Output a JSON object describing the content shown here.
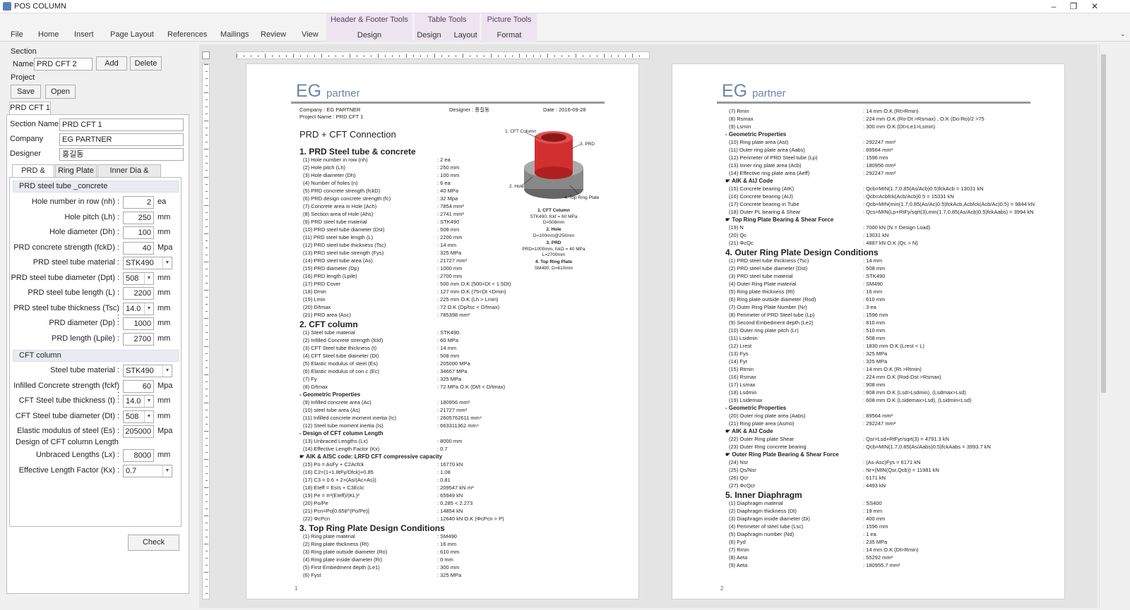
{
  "window": {
    "title": "POS COLUMN",
    "min_glyph": "–",
    "restore_glyph": "❐",
    "close_glyph": "✕"
  },
  "ribbon": {
    "tabs": [
      "File",
      "Home",
      "Insert",
      "Page Layout",
      "References",
      "Mailings",
      "Review",
      "View"
    ],
    "context_groups": [
      {
        "title": "Header & Footer Tools",
        "tabs": [
          "Design"
        ]
      },
      {
        "title": "Table Tools",
        "tabs": [
          "Design",
          "Layout"
        ]
      },
      {
        "title": "Picture Tools",
        "tabs": [
          "Format"
        ]
      }
    ]
  },
  "left": {
    "section_group": "Section",
    "name_label": "Name",
    "name_value": "PRD CFT 2",
    "add_btn": "Add",
    "delete_btn": "Delete",
    "project_group": "Project",
    "save_btn": "Save",
    "open_btn": "Open",
    "section_tab": "PRD CFT 1",
    "section_name_label": "Section Name",
    "section_name_value": "PRD CFT 1",
    "company_label": "Company",
    "company_value": "EG PARTNER",
    "designer_label": "Designer",
    "designer_value": "홍길동",
    "subtabs": [
      "PRD & CFT",
      "Ring Plate",
      "Inner Dia & LOAD"
    ],
    "prd_header": "PRD steel tube _concrete",
    "prd_fields": [
      {
        "label": "Hole number in row (nh) :",
        "value": "2",
        "unit": "ea",
        "type": "num"
      },
      {
        "label": "Hole pitch (Lh) :",
        "value": "250",
        "unit": "mm",
        "type": "num"
      },
      {
        "label": "Hole diameter (Dh) :",
        "value": "100",
        "unit": "mm",
        "type": "num"
      },
      {
        "label": "PRD concrete strength (fckD) :",
        "value": "40",
        "unit": "Mpa",
        "type": "num"
      },
      {
        "label": "PRD steel tube material :",
        "value": "STK490",
        "unit": "",
        "type": "combo"
      },
      {
        "label": "PRD steel tube diameter (Dpt) :",
        "value": "508",
        "unit": "mm",
        "type": "combo"
      },
      {
        "label": "PRD steel tube length (L) :",
        "value": "2200",
        "unit": "mm",
        "type": "num"
      },
      {
        "label": "PRD steel tube thickness (Tsc) :",
        "value": "14.0",
        "unit": "mm",
        "type": "combo"
      },
      {
        "label": "PRD diameter (Dp) :",
        "value": "1000",
        "unit": "mm",
        "type": "num"
      },
      {
        "label": "PRD length (Lpile) :",
        "value": "2700",
        "unit": "mm",
        "type": "num"
      }
    ],
    "cft_header": "CFT column",
    "cft_fields": [
      {
        "label": "Steel tube material :",
        "value": "STK490",
        "unit": "",
        "type": "combo"
      },
      {
        "label": "Infilled Concrete strength (fckf) :",
        "value": "60",
        "unit": "Mpa",
        "type": "num"
      },
      {
        "label": "CFT Steel tube thickness (t) :",
        "value": "14.0",
        "unit": "mm",
        "type": "combo"
      },
      {
        "label": "CFT Steel tube diameter (Dt) :",
        "value": "508",
        "unit": "mm",
        "type": "combo"
      },
      {
        "label": "Elastic modulus of steel (Es) :",
        "value": "205000",
        "unit": "Mpa",
        "type": "num"
      }
    ],
    "design_length_label": "Design of CFT column Length",
    "len_fields": [
      {
        "label": "Unbraced Lengths (Lx) :",
        "value": "8000",
        "unit": "mm",
        "type": "num"
      },
      {
        "label": "Effective Length Factor (Kx) :",
        "value": "0.7",
        "unit": "",
        "type": "combo"
      }
    ],
    "check_btn": "Check"
  },
  "page1": {
    "logo_big": "EG",
    "logo_small": "partner",
    "company_line": "Company :   EG PARTNER",
    "project_line": "Project Name :   PRD CFT 1",
    "designer_line": "Designer :   홍길동",
    "date_line": "Date :  2016-09-28",
    "title": "PRD + CFT Connection",
    "figure_labels": [
      "1. CFT Column",
      "2. Hole",
      "3. PRD",
      "4. Top Ring Plate"
    ],
    "figure_notes": [
      "1. CFT Column",
      "STK490, fckf = 60 MPa",
      "D=508mm",
      "2. Hole",
      "D=100mm@250mm",
      "3. PRD",
      "PRD=1000mm, fckD = 40 MPa",
      "L=2700mm",
      "4. Top Ring Plate",
      "SM490, D=610mm"
    ],
    "pagenum": "1",
    "blocks": [
      {
        "h": "1. PRD Steel tube & concrete",
        "lines": [
          [
            "(1) Hole number in row (nh)",
            ": 2 ea"
          ],
          [
            "(2) Hole pitch (Lh)",
            ": 250 mm"
          ],
          [
            "(3) Hole diameter (Dh)",
            ": 100 mm"
          ],
          [
            "(4) Number of holes (n)",
            ": 6 ea"
          ],
          [
            "(5) PRD concrete strength (fckD)",
            ": 40 MPa"
          ],
          [
            "(6) PRD design concrete strength (fc)",
            ": 32 Mpa"
          ],
          [
            "(7) Concrete area in Hole (Ach)",
            ": 7854 mm²"
          ],
          [
            "(8) Section area of Hole (Ahs)",
            ": 2741 mm²"
          ],
          [
            "(9) PRD steel tube material",
            ": STK490"
          ],
          [
            "(10) PRD steel tube diameter (Dst)",
            ": 508 mm"
          ],
          [
            "(11) PRD steel tube length (L)",
            ": 2200 mm"
          ],
          [
            "(12) PRD steel tube thickness (Tsc)",
            ": 14 mm"
          ],
          [
            "(13) PRD steel tube strength (Fys)",
            ": 325 MPa"
          ],
          [
            "(14) PRD steel tube area (As)",
            ": 21727 mm²"
          ],
          [
            "(15) PRD diameter (Dp)",
            ": 1000 mm"
          ],
          [
            "(16) PRD length (Lpile)",
            ": 2700 mm"
          ],
          [
            "(17) PRD Cover",
            ": 500 mm  O.K  (500<Dt < 1.5Dt)"
          ],
          [
            "(18) Dmin",
            ": 127 mm  O.K  (75<Dt <Dmin)"
          ],
          [
            "(19) Lmin",
            ": 225 mm  O.K  (Lh > Lmin)"
          ],
          [
            "(20) D/tmax",
            ": 72   O.K  (Dp/tsc < D/tmax)"
          ],
          [
            "(21) PRD area (Asc)",
            ": 785398 mm²"
          ]
        ]
      },
      {
        "h": "2. CFT column",
        "lines": [
          [
            "(1) Steel tube material",
            ": STK490"
          ],
          [
            "(2) Infilled Concrete strength (fckf)",
            ": 60 MPa"
          ],
          [
            "(3) CFT Steel tube thickness (t)",
            ": 14 mm"
          ],
          [
            "(4) CFT Steel tube diameter (Dt)",
            ": 508 mm"
          ],
          [
            "(5) Elastic modulus of steel (Es)",
            ": 205000 MPa"
          ],
          [
            "(6) Elastic modulus of con c (Ec)",
            ": 34667 MPa"
          ],
          [
            "(7) Fy",
            ": 325 MPa"
          ],
          [
            "(8) D/tmax",
            ": 72 MPa  O.K  (Dt/t < D/tmax)"
          ]
        ]
      },
      {
        "sub": "- Geometric Properties",
        "lines": [
          [
            "(9) Infilled concrete area (Ac)",
            ": 180956 mm²"
          ],
          [
            "(10) steel tube area (As)",
            ": 21727 mm²"
          ],
          [
            "(11) Infilled concrete moment inertia (Ic)",
            ": 2605762611 mm⁴"
          ],
          [
            "(12) Steel tube moment inertia (Is)",
            ": 663311362 mm⁴"
          ]
        ]
      },
      {
        "sub": "- Design of CFT column Length",
        "lines": [
          [
            "(13) Unbraced Lengths (Lx)",
            ": 8000 mm"
          ],
          [
            "(14) Effective Length Factor (Kx)",
            ": 0.7"
          ]
        ]
      },
      {
        "sub": "☛ AIK & AISC code: LRFD CFT compressive capacity",
        "lines": [
          [
            "(15) Po = AsFy + C2Acfck",
            ": 16770 kN"
          ],
          [
            "(16) C2=(1+1.8tFy/Dfck)+0.85",
            ": 1.08"
          ],
          [
            "(17) C3 = 0.6 + 2×(As/(Ac+As))",
            ": 0.81"
          ],
          [
            "(18) EIeff = EsIs + C3EcIc",
            ": 209547 kN·m²"
          ],
          [
            "(19) Pe = π²(EIeff)/(KL)²",
            ": 65949 kN"
          ],
          [
            "(20) Po/Pe",
            ": 0.285  <  2.273"
          ],
          [
            "(21) Pcn=Po[0.658^(Po/Pe)]",
            ": 14854 kN"
          ],
          [
            "(22) ΦcPcn",
            ": 12640 kN  O.K   (ΦcPcn > P)"
          ]
        ]
      },
      {
        "h": "3. Top Ring Plate Design Conditions",
        "lines": [
          [
            "(1) Ring plate material",
            ": SM490"
          ],
          [
            "(2) Ring plate thickness (Rt)",
            ": 16 mm"
          ],
          [
            "(3) Ring plate outside diameter (Ro)",
            ": 610 mm"
          ],
          [
            "(4) Ring plate inside diameter (Ri)",
            ": 0 mm"
          ],
          [
            "(5) First Embedment depth (Le1)",
            ": 300 mm"
          ],
          [
            "(6) Fyst",
            ": 325 MPa"
          ]
        ]
      }
    ]
  },
  "page2": {
    "logo_big": "EG",
    "logo_small": "partner",
    "pagenum": "2",
    "blocks": [
      {
        "lines": [
          [
            "(7) Rmin",
            ": 14 mm  O.K  (Rt>Rmin)"
          ],
          [
            "(8) Rsmax",
            ": 224 mm  O.K  (Ro-Dt >Rsmax) ,    O.K   (Do-Ro)/2 >75"
          ],
          [
            "(9) Lsmin",
            ": 300 mm  O.K  (Dt>Le1>Lsmin)"
          ]
        ]
      },
      {
        "sub": "- Geometric Properties",
        "lines": [
          [
            "(10) Ring plate area (Ast)",
            ": 292247 mm²"
          ],
          [
            "(11) Outer ring plate area (Aabs)",
            ": 89564 mm²"
          ],
          [
            "(12) Perimeter of PRD Steel tube (Lp)",
            ": 1596 mm"
          ],
          [
            "(13) Inner ring plate area (Acb)",
            ": 180956 mm²"
          ],
          [
            "(14) Effective ring plate area (Aeff)",
            ": 292247 mm²"
          ]
        ]
      },
      {
        "sub": "☛ AIK & AIJ Code",
        "lines": [
          [
            "(15) Concrete bearing (AIK)",
            ":  Qcb=MIN(1.7,0.85(As/Acb)0.5)fckAcb  =  13031 kN"
          ],
          [
            "(16) Concrete bearing (AIJ)",
            ":  Qcb=Acbfck(Acb/Acb)0.5  =  15331 kN"
          ],
          [
            "(17) Concrete bearing in Tube",
            ":  Qcb=MIN(min(1.7,0.85(As/Ac)0.5)fckAcb,Acbfck(Acb/Ac)0.5) = 9844 kN"
          ],
          [
            "(18) Outer PL bearing & Shear",
            ":  Qcs=MIN(Lp+RtFy/sqrt(3),min(1.7,0.85(As/Acb)0.5)fckAabs) = 3994 kN"
          ]
        ]
      },
      {
        "sub": "☛ Top Ring Plate Bearing & Shear Force",
        "lines": [
          [
            "(19) N",
            ": 7000 kN  (N = Design Load)"
          ],
          [
            "(20) Qc",
            ": 13031 kN"
          ],
          [
            "(21) ΦcQc",
            ": 4887 kN  O.K   (Qc > N)"
          ]
        ]
      },
      {
        "h": "4. Outer Ring Plate Design Conditions",
        "lines": [
          [
            "(1) PRD steel tube thickness (Tsc)",
            ": 14 mm"
          ],
          [
            "(2) PRD steel tube diameter (Dst)",
            ": 508 mm"
          ],
          [
            "(3) PRD steel tube material",
            ": STK490"
          ],
          [
            "(4) Outer Ring Plate material",
            ": SM490"
          ],
          [
            "(5) Ring plate thickness (Rt)",
            ": 16 mm"
          ],
          [
            "(6) Ring plate outside diameter (Rod)",
            ": 610 mm"
          ],
          [
            "(7) Outer Ring Plate Number (Nr)",
            ": 3 ea"
          ],
          [
            "(8) Perimeter of PRD Steel tube (Lp)",
            ": 1596 mm"
          ],
          [
            "(9) Second Embedment depth (Le2)",
            ": 810 mm"
          ],
          [
            "(10) Outer ring plate pitch (Lr)",
            ": 510 mm"
          ],
          [
            "(11) Lsidmin",
            ": 508 mm"
          ],
          [
            "(12) Lrest",
            ": 1830 mm  O.K   (Lrest < L)"
          ],
          [
            "(13) Fys",
            ": 325 MPa"
          ],
          [
            "(14) Fyr",
            ": 325 MPa"
          ],
          [
            "(15) Rtmin",
            ": 14 mm  O.K   (Rt >Rtmin)"
          ],
          [
            "(16) Rsmax",
            ": 224 mm  O.K   (Rod-Dst >Rsmax)"
          ],
          [
            "(17) Lsmax",
            ": 908 mm"
          ],
          [
            "(18) Lsdmin",
            ": 808 mm  O.K   (Lsd>Lsdmin),  (Lsdmax>Lsd)"
          ],
          [
            "(19) Lsidemax",
            ": 608 mm  O.K   (Lsidemax>Lsd),  (Lsidmin<Lsd)"
          ]
        ]
      },
      {
        "sub": "- Geometric Properties",
        "lines": [
          [
            "(20) Outer ring plate area (Aabs)",
            ": 89564 mm²"
          ],
          [
            "(21) Ring plate area (Asmo)",
            ": 292247 mm²"
          ]
        ]
      },
      {
        "sub": "☛ AIK & AIJ Code",
        "lines": [
          [
            "(22) Outer Ring plate Shear",
            ":  Qsr=Lsd+RtFyr/sqrt(3) = 4791.3 kN"
          ],
          [
            "(23) Outer Ring concrete bearing",
            ":  Qcb=MIN(1.7,0.85(As/Aabs)0.5)fckAabs = 3993.7 kN"
          ]
        ]
      },
      {
        "sub": "☛ Outer Ring Plate Bearing & Shear Force",
        "lines": [
          [
            "(24) Nsr",
            ":  (As-Asc)Fys = 6171 kN"
          ],
          [
            "(25) Qs/Nsr",
            ":  Nr×(MIN(Qsr,Qcb)) = 11981 kN"
          ],
          [
            "(26) Qcr",
            ": 6171 kN"
          ],
          [
            "(27) ΦcQcr",
            ": 4493 kN"
          ]
        ]
      },
      {
        "h": "5. Inner Diaphragm",
        "lines": [
          [
            "(1) Diaphragm material",
            ": SS400"
          ],
          [
            "(2) Diaphragm thickness (Dt)",
            ": 19 mm"
          ],
          [
            "(3) Diaphragm inside diameter (Di)",
            ": 400 mm"
          ],
          [
            "(4) Perimeter of steel tube (Lsc)",
            ": 1596 mm"
          ],
          [
            "(5) Diaphragm number (Nd)",
            ": 1 ea"
          ],
          [
            "(6) Fyd",
            ": 235 MPa"
          ],
          [
            "(7) Rmin",
            ": 14 mm  O.K   (Dt>Rmin)"
          ],
          [
            "(8) Aeta",
            ": 55292 mm²"
          ],
          [
            "(9) Aeta",
            ": 180955.7 mm²"
          ]
        ]
      }
    ]
  }
}
